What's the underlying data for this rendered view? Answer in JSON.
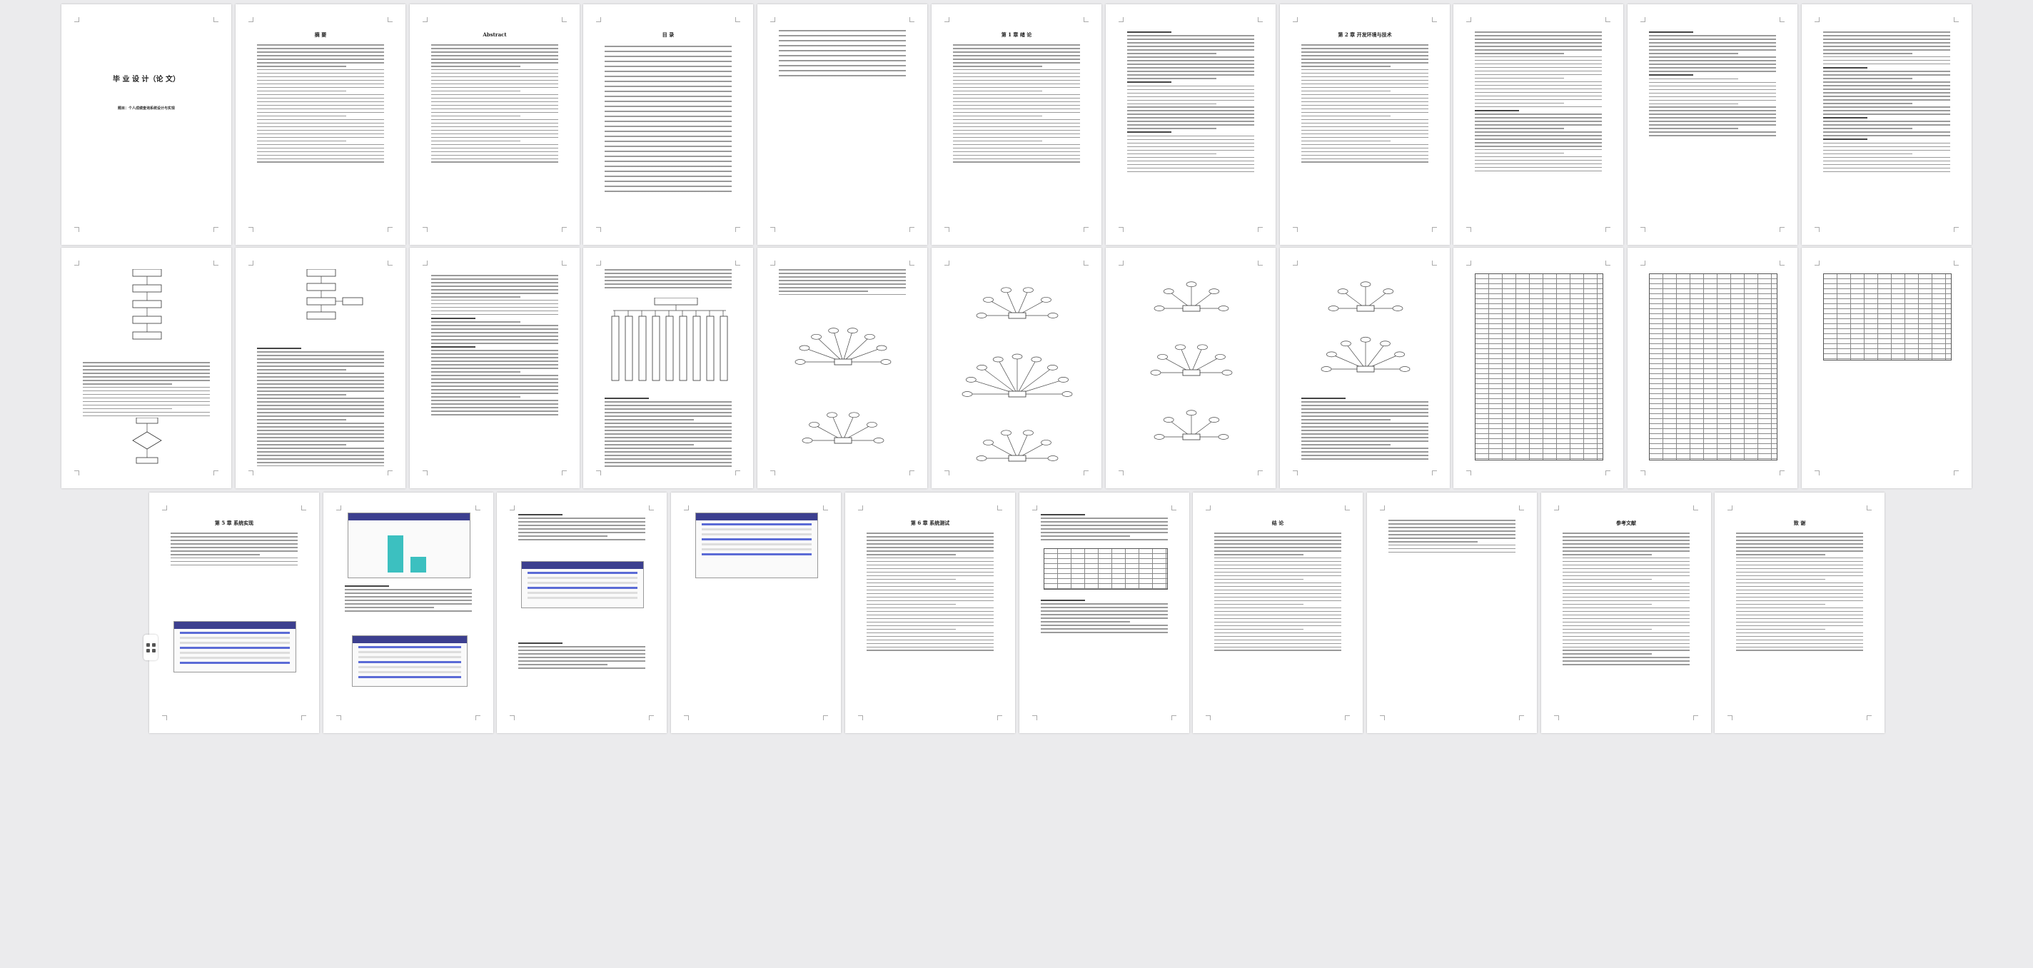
{
  "thesis": {
    "cover_title": "毕 业 设 计（论 文）",
    "cover_subtitle": "题目：个人成绩查询系统设计与实现",
    "abstract_cn_heading": "摘 要",
    "abstract_en_heading": "Abstract",
    "toc_heading": "目 录",
    "ch1": "第 1 章 绪 论",
    "ch2": "第 2 章 开发环境与技术",
    "ch5": "第 5 章 系统实现",
    "ch6": "第 6 章 系统测试",
    "conclusion": "结 论",
    "references": "参考文献",
    "thanks": "致 谢"
  },
  "toolbar": {
    "icon": "thumbnail-grid-icon"
  }
}
